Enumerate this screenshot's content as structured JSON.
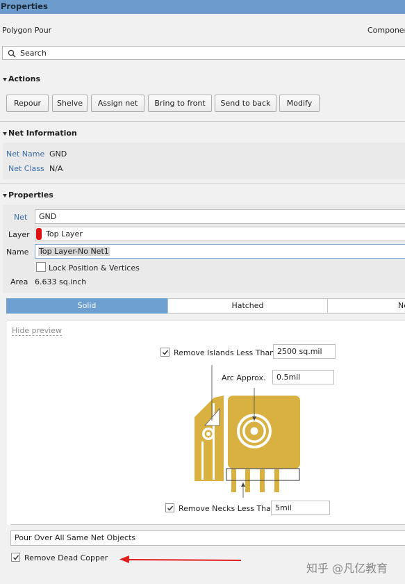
{
  "window": {
    "title": "Properties"
  },
  "header": {
    "object_type": "Polygon Pour",
    "right_label": "Componer"
  },
  "search": {
    "placeholder": "Search"
  },
  "actions": {
    "section_label": "Actions",
    "buttons": [
      "Repour",
      "Shelve",
      "Assign net",
      "Bring to front",
      "Send to back",
      "Modify"
    ]
  },
  "net_info": {
    "section_label": "Net Information",
    "net_name_label": "Net Name",
    "net_name_value": "GND",
    "net_class_label": "Net Class",
    "net_class_value": "N/A"
  },
  "properties": {
    "section_label": "Properties",
    "net_label": "Net",
    "net_value": "GND",
    "layer_label": "Layer",
    "layer_value": "Top Layer",
    "layer_color": "#e01010",
    "name_label": "Name",
    "name_value": "Top Layer-No Net1",
    "lock_label": "Lock Position & Vertices",
    "lock_checked": false,
    "area_label": "Area",
    "area_value": "6.633 sq.inch"
  },
  "fill_mode": {
    "options": [
      "Solid",
      "Hatched",
      "No"
    ],
    "selected": "Solid"
  },
  "preview": {
    "hide_link": "Hide preview",
    "remove_islands_label": "Remove Islands Less Than",
    "remove_islands_checked": true,
    "remove_islands_value": "2500 sq.mil",
    "arc_label": "Arc Approx.",
    "arc_value": "0.5mil",
    "remove_necks_label": "Remove Necks Less Than",
    "remove_necks_checked": true,
    "remove_necks_value": "5mil",
    "copper_color": "#d8b141"
  },
  "pour_over": {
    "value": "Pour Over All Same Net Objects"
  },
  "dead_copper": {
    "label": "Remove Dead Copper",
    "checked": true
  },
  "annotation": {
    "arrow_color": "#e01e1e"
  },
  "watermark": {
    "text": "知乎 @凡亿教育"
  }
}
